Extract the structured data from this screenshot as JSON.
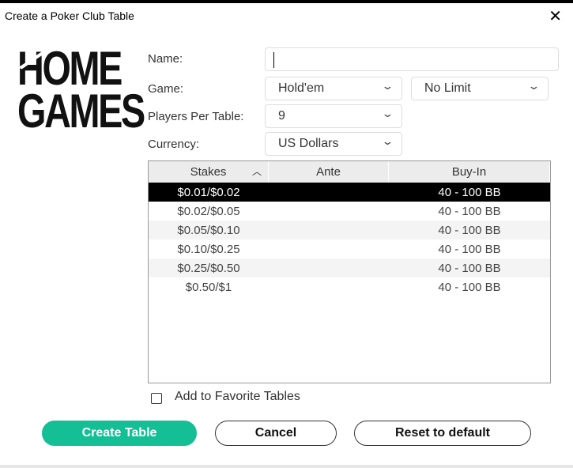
{
  "window": {
    "title": "Create a Poker Club Table",
    "close_icon": "close-icon"
  },
  "logo": {
    "line1": "HOME",
    "line2": "GAMES"
  },
  "form": {
    "name_label": "Name:",
    "name_value": "",
    "game_label": "Game:",
    "game_value": "Hold'em",
    "limit_value": "No Limit",
    "players_label": "Players Per Table:",
    "players_value": "9",
    "currency_label": "Currency:",
    "currency_value": "US Dollars"
  },
  "table": {
    "headers": [
      "Stakes",
      "Ante",
      "Buy-In"
    ],
    "sort": "Stakes ascending",
    "rows": [
      {
        "stakes": "$0.01/$0.02",
        "ante": "",
        "buyin": "40 - 100 BB",
        "selected": true
      },
      {
        "stakes": "$0.02/$0.05",
        "ante": "",
        "buyin": "40 - 100 BB"
      },
      {
        "stakes": "$0.05/$0.10",
        "ante": "",
        "buyin": "40 - 100 BB"
      },
      {
        "stakes": "$0.10/$0.25",
        "ante": "",
        "buyin": "40 - 100 BB"
      },
      {
        "stakes": "$0.25/$0.50",
        "ante": "",
        "buyin": "40 - 100 BB"
      },
      {
        "stakes": "$0.50/$1",
        "ante": "",
        "buyin": "40 - 100 BB"
      }
    ]
  },
  "favorite": {
    "label": "Add to Favorite Tables",
    "checked": false
  },
  "buttons": {
    "create": "Create Table",
    "cancel": "Cancel",
    "reset": "Reset to default"
  },
  "colors": {
    "accent": "#14bf96",
    "selected_row": "#000000"
  }
}
